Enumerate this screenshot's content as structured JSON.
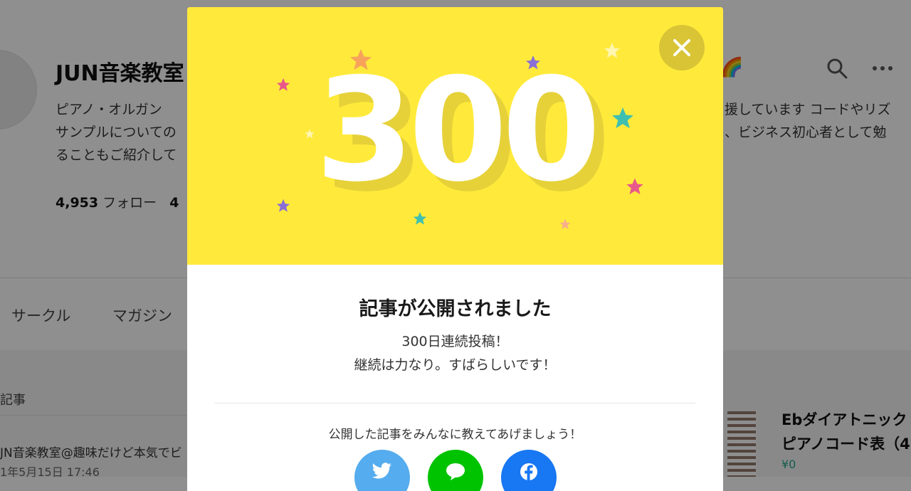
{
  "background": {
    "profile": {
      "name": "JUN音楽教室",
      "bio_left": [
        "ピアノ・オルガン",
        "サンプルについての",
        "ることもご紹介して"
      ],
      "bio_right": [
        "援しています コードやリズ",
        "、ビジネス初心者として勉"
      ],
      "follow_count": "4,953",
      "follow_label": "フォロー",
      "follower_count_partial": "4"
    },
    "tabs": [
      "サークル",
      "マガジン"
    ],
    "section_label": "記事",
    "article": {
      "author": "JN音楽教室@趣味だけど本気でビ",
      "date": "1年5月15日 17:46"
    },
    "right_card": {
      "title_line1": "Ebダイアトニック",
      "title_line2": "ピアノコード表（4",
      "price": "¥0"
    }
  },
  "modal": {
    "count": "300",
    "title": "記事が公開されました",
    "message_line1": "300日連続投稿！",
    "message_line2": "継続は力なり。すばらしいです！",
    "share_prompt": "公開した記事をみんなに教えてあげましょう！",
    "share_buttons": [
      {
        "icon": "twitter-icon",
        "color": "#55acee"
      },
      {
        "icon": "line-icon",
        "color": "#00c300"
      },
      {
        "icon": "facebook-icon",
        "color": "#1877f2"
      }
    ],
    "hero_color": "#ffea3b",
    "close_icon": "close-icon"
  }
}
